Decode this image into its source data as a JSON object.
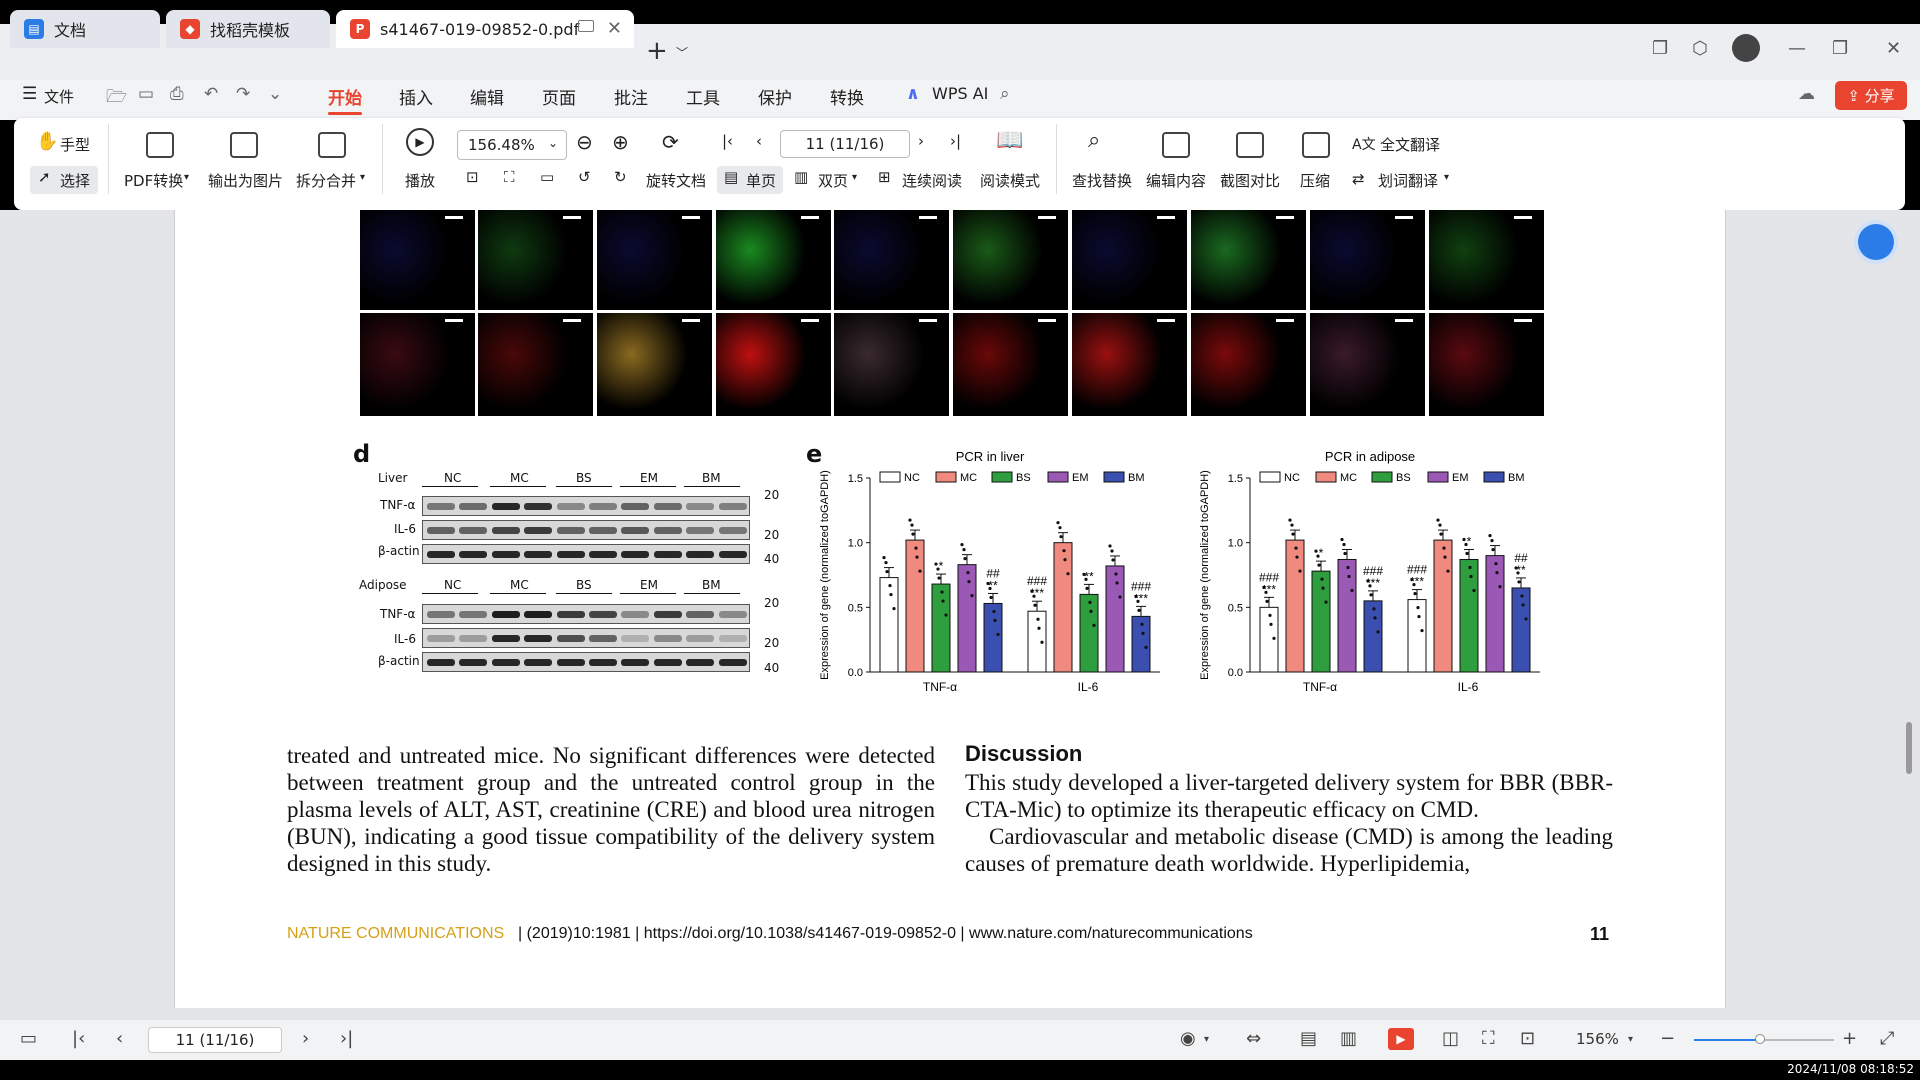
{
  "tabs": [
    {
      "label": "文档"
    },
    {
      "label": "找稻壳模板"
    },
    {
      "label": "s41467-019-09852-0.pdf"
    }
  ],
  "menu": {
    "file": "文件",
    "items": [
      "开始",
      "插入",
      "编辑",
      "页面",
      "批注",
      "工具",
      "保护",
      "转换"
    ],
    "wps_ai": "WPS AI",
    "share": "分享"
  },
  "ribbon": {
    "hand": "手型",
    "select": "选择",
    "pdf_convert": "PDF转换",
    "export_image": "输出为图片",
    "split_merge": "拆分合并",
    "play": "播放",
    "zoom": "156.48%",
    "page": "11 (11/16)",
    "rotate": "旋转文档",
    "single": "单页",
    "double": "双页",
    "continuous": "连续阅读",
    "read_mode": "阅读模式",
    "find_replace": "查找替换",
    "edit_content": "编辑内容",
    "screenshot_compare": "截图对比",
    "compress": "压缩",
    "full_translate": "全文翻译",
    "word_translate": "划词翻译"
  },
  "figure": {
    "d_label": "d",
    "e_label": "e",
    "wb_liver": {
      "tissue": "Liver",
      "groups": [
        "NC",
        "MC",
        "BS",
        "EM",
        "BM"
      ],
      "rows": [
        "TNF-α",
        "IL-6",
        "β-actin"
      ],
      "markers": [
        "20",
        "20",
        "40"
      ]
    },
    "wb_adipose": {
      "tissue": "Adipose",
      "groups": [
        "NC",
        "MC",
        "BS",
        "EM",
        "BM"
      ],
      "rows": [
        "TNF-α",
        "IL-6",
        "β-actin"
      ],
      "markers": [
        "20",
        "20",
        "40"
      ]
    }
  },
  "chart_data": [
    {
      "type": "bar",
      "title": "PCR in liver",
      "ylabel": "Expression of gene (normalized toGAPDH)",
      "ylim": [
        0,
        1.5
      ],
      "yticks": [
        "0.0",
        "0.5",
        "1.0",
        "1.5"
      ],
      "categories": [
        "TNF-α",
        "IL-6"
      ],
      "series": [
        {
          "name": "NC",
          "values": [
            0.73,
            0.47
          ],
          "color": "#ffffff"
        },
        {
          "name": "MC",
          "values": [
            1.02,
            1.0
          ],
          "color": "#f08a7e"
        },
        {
          "name": "BS",
          "values": [
            0.68,
            0.6
          ],
          "color": "#2e9e3e"
        },
        {
          "name": "EM",
          "values": [
            0.83,
            0.82
          ],
          "color": "#9b59b6"
        },
        {
          "name": "BM",
          "values": [
            0.53,
            0.43
          ],
          "color": "#3b4fb0"
        }
      ],
      "annotations": [
        {
          "category": "TNF-α",
          "series": "BS",
          "text": "*"
        },
        {
          "category": "TNF-α",
          "series": "BM",
          "text": "## **"
        },
        {
          "category": "IL-6",
          "series": "NC",
          "text": "### ***"
        },
        {
          "category": "IL-6",
          "series": "BS",
          "text": "**"
        },
        {
          "category": "IL-6",
          "series": "BM",
          "text": "### ***"
        }
      ]
    },
    {
      "type": "bar",
      "title": "PCR in adipose",
      "ylabel": "Expression of gene (normalized toGAPDH)",
      "ylim": [
        0,
        1.5
      ],
      "yticks": [
        "0.0",
        "0.5",
        "1.0",
        "1.5"
      ],
      "categories": [
        "TNF-α",
        "IL-6"
      ],
      "series": [
        {
          "name": "NC",
          "values": [
            0.5,
            0.56
          ],
          "color": "#ffffff"
        },
        {
          "name": "MC",
          "values": [
            1.02,
            1.02
          ],
          "color": "#f08a7e"
        },
        {
          "name": "BS",
          "values": [
            0.78,
            0.87
          ],
          "color": "#2e9e3e"
        },
        {
          "name": "EM",
          "values": [
            0.87,
            0.9
          ],
          "color": "#9b59b6"
        },
        {
          "name": "BM",
          "values": [
            0.55,
            0.65
          ],
          "color": "#3b4fb0"
        }
      ],
      "annotations": [
        {
          "category": "TNF-α",
          "series": "NC",
          "text": "### ***"
        },
        {
          "category": "TNF-α",
          "series": "BS",
          "text": "*"
        },
        {
          "category": "TNF-α",
          "series": "BM",
          "text": "### ***"
        },
        {
          "category": "IL-6",
          "series": "NC",
          "text": "### ***"
        },
        {
          "category": "IL-6",
          "series": "BS",
          "text": "*"
        },
        {
          "category": "IL-6",
          "series": "BM",
          "text": "## **"
        }
      ]
    }
  ],
  "body": {
    "left_para": "treated and untreated mice. No significant differences were detected between treatment group and the untreated control group in the plasma levels of ALT, AST, creatinine (CRE) and blood urea nitrogen (BUN), indicating a good tissue compatibility of the delivery system designed in this study.",
    "discussion_heading": "Discussion",
    "right_para1": "This study developed a liver-targeted delivery system for BBR (BBR-CTA-Mic) to optimize its therapeutic efficacy on CMD.",
    "right_para2": "Cardiovascular and metabolic disease (CMD) is among the leading causes of premature death worldwide. Hyperlipidemia,"
  },
  "footer": {
    "journal": "NATURE COMMUNICATIONS",
    "citation": "| (2019)10:1981 | https://doi.org/10.1038/s41467-019-09852-0 | www.nature.com/naturecommunications",
    "page_num": "11"
  },
  "statusbar": {
    "page": "11 (11/16)",
    "zoom": "156%"
  },
  "clock": "2024/11/08 08:18:52",
  "colors": {
    "accent": "#e8442f",
    "journal": "#d4a017"
  }
}
